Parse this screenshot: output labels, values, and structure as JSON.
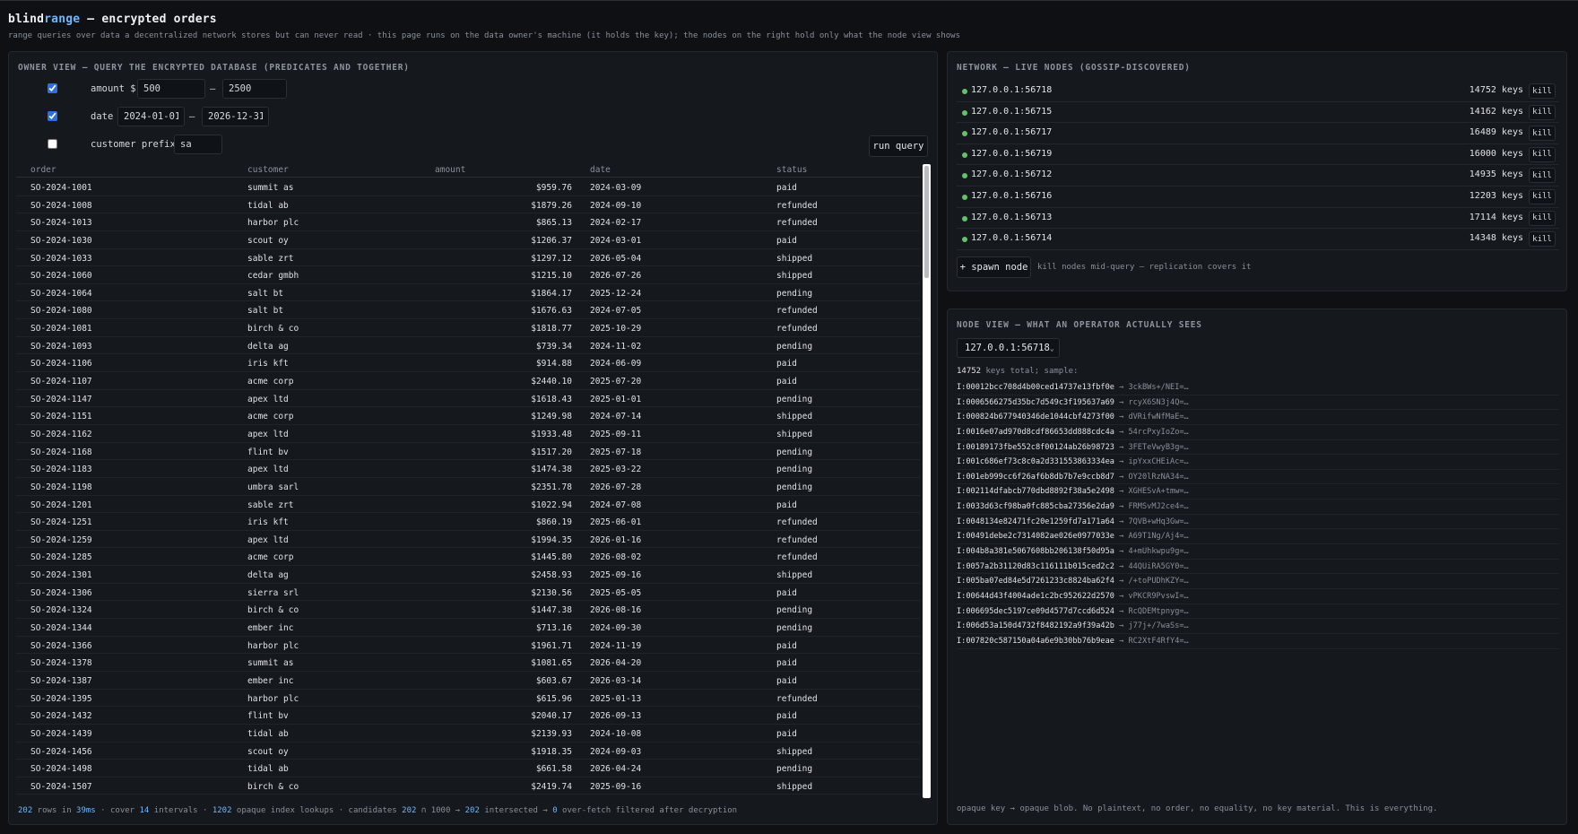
{
  "header": {
    "title_a": "blind",
    "title_b": "range",
    "title_c": " — encrypted orders",
    "subtitle": "range queries over data a decentralized network stores but can never read · this page runs on the data owner's machine (it holds the key); the nodes on the right hold only what the node view shows"
  },
  "owner": {
    "title": "owner view — query the encrypted database (predicates and together)",
    "filters": {
      "amount_label": "amount $",
      "amount_min": "500",
      "amount_max": "2500",
      "date_label": "date",
      "date_min": "2024-01-01",
      "date_max": "2026-12-31",
      "prefix_label": "customer prefix",
      "prefix_value": "sa",
      "dash": "—"
    },
    "run_label": "run query",
    "columns": {
      "order": "order",
      "customer": "customer",
      "amount": "amount",
      "date": "date",
      "status": "status"
    },
    "rows": [
      [
        "SO-2024-1001",
        "summit as",
        "$959.76",
        "2024-03-09",
        "paid"
      ],
      [
        "SO-2024-1008",
        "tidal ab",
        "$1879.26",
        "2024-09-10",
        "refunded"
      ],
      [
        "SO-2024-1013",
        "harbor plc",
        "$865.13",
        "2024-02-17",
        "refunded"
      ],
      [
        "SO-2024-1030",
        "scout oy",
        "$1206.37",
        "2024-03-01",
        "paid"
      ],
      [
        "SO-2024-1033",
        "sable zrt",
        "$1297.12",
        "2026-05-04",
        "shipped"
      ],
      [
        "SO-2024-1060",
        "cedar gmbh",
        "$1215.10",
        "2026-07-26",
        "shipped"
      ],
      [
        "SO-2024-1064",
        "salt bt",
        "$1864.17",
        "2025-12-24",
        "pending"
      ],
      [
        "SO-2024-1080",
        "salt bt",
        "$1676.63",
        "2024-07-05",
        "refunded"
      ],
      [
        "SO-2024-1081",
        "birch & co",
        "$1818.77",
        "2025-10-29",
        "refunded"
      ],
      [
        "SO-2024-1093",
        "delta ag",
        "$739.34",
        "2024-11-02",
        "pending"
      ],
      [
        "SO-2024-1106",
        "iris kft",
        "$914.88",
        "2024-06-09",
        "paid"
      ],
      [
        "SO-2024-1107",
        "acme corp",
        "$2440.10",
        "2025-07-20",
        "paid"
      ],
      [
        "SO-2024-1147",
        "apex ltd",
        "$1618.43",
        "2025-01-01",
        "pending"
      ],
      [
        "SO-2024-1151",
        "acme corp",
        "$1249.98",
        "2024-07-14",
        "shipped"
      ],
      [
        "SO-2024-1162",
        "apex ltd",
        "$1933.48",
        "2025-09-11",
        "shipped"
      ],
      [
        "SO-2024-1168",
        "flint bv",
        "$1517.20",
        "2025-07-18",
        "pending"
      ],
      [
        "SO-2024-1183",
        "apex ltd",
        "$1474.38",
        "2025-03-22",
        "pending"
      ],
      [
        "SO-2024-1198",
        "umbra sarl",
        "$2351.78",
        "2026-07-28",
        "pending"
      ],
      [
        "SO-2024-1201",
        "sable zrt",
        "$1022.94",
        "2024-07-08",
        "paid"
      ],
      [
        "SO-2024-1251",
        "iris kft",
        "$860.19",
        "2025-06-01",
        "refunded"
      ],
      [
        "SO-2024-1259",
        "apex ltd",
        "$1994.35",
        "2026-01-16",
        "refunded"
      ],
      [
        "SO-2024-1285",
        "acme corp",
        "$1445.80",
        "2026-08-02",
        "refunded"
      ],
      [
        "SO-2024-1301",
        "delta ag",
        "$2458.93",
        "2025-09-16",
        "shipped"
      ],
      [
        "SO-2024-1306",
        "sierra srl",
        "$2130.56",
        "2025-05-05",
        "paid"
      ],
      [
        "SO-2024-1324",
        "birch & co",
        "$1447.38",
        "2026-08-16",
        "pending"
      ],
      [
        "SO-2024-1344",
        "ember inc",
        "$713.16",
        "2024-09-30",
        "pending"
      ],
      [
        "SO-2024-1366",
        "harbor plc",
        "$1961.71",
        "2024-11-19",
        "paid"
      ],
      [
        "SO-2024-1378",
        "summit as",
        "$1081.65",
        "2026-04-20",
        "paid"
      ],
      [
        "SO-2024-1387",
        "ember inc",
        "$603.67",
        "2026-03-14",
        "paid"
      ],
      [
        "SO-2024-1395",
        "harbor plc",
        "$615.96",
        "2025-01-13",
        "refunded"
      ],
      [
        "SO-2024-1432",
        "flint bv",
        "$2040.17",
        "2026-09-13",
        "paid"
      ],
      [
        "SO-2024-1439",
        "tidal ab",
        "$2139.93",
        "2024-10-08",
        "paid"
      ],
      [
        "SO-2024-1456",
        "scout oy",
        "$1918.35",
        "2024-09-03",
        "shipped"
      ],
      [
        "SO-2024-1498",
        "tidal ab",
        "$661.58",
        "2026-04-24",
        "pending"
      ],
      [
        "SO-2024-1507",
        "birch & co",
        "$2419.74",
        "2025-09-16",
        "shipped"
      ]
    ],
    "stats": {
      "rows": "202",
      "rows_text": " rows in ",
      "ms": "39ms",
      "cover_text": " · cover ",
      "intervals": "14",
      "intervals_text": " intervals · ",
      "lookups": "1202",
      "lookups_text": " opaque index lookups · candidates ",
      "cand_a": "202",
      "cap_text": " ∩ ",
      "cand_b": "1000",
      "arrow1": " → ",
      "intersected": "202",
      "inter_text": " intersected → ",
      "overfetch": "0",
      "over_text": " over-fetch filtered after decryption"
    }
  },
  "network": {
    "title": "network — live nodes (gossip-discovered)",
    "nodes": [
      {
        "addr": "127.0.0.1:56718",
        "keys": "14752 keys"
      },
      {
        "addr": "127.0.0.1:56715",
        "keys": "14162 keys"
      },
      {
        "addr": "127.0.0.1:56717",
        "keys": "16489 keys"
      },
      {
        "addr": "127.0.0.1:56719",
        "keys": "16000 keys"
      },
      {
        "addr": "127.0.0.1:56712",
        "keys": "14935 keys"
      },
      {
        "addr": "127.0.0.1:56716",
        "keys": "12203 keys"
      },
      {
        "addr": "127.0.0.1:56713",
        "keys": "17114 keys"
      },
      {
        "addr": "127.0.0.1:56714",
        "keys": "14348 keys"
      }
    ],
    "kill_label": "kill",
    "spawn_label": "+ spawn node",
    "spawn_hint": "kill nodes mid-query — replication covers it",
    "status_color": "#62c26b"
  },
  "nodeview": {
    "title": "node view — what an operator actually sees",
    "selected": "127.0.0.1:56718",
    "keys_total": "14752",
    "keys_text": " keys total; sample:",
    "arrow": " → ",
    "samples": [
      [
        "I:00012bcc708d4b00ced14737e13fbf0e",
        "3ckBWs+/NEI=…"
      ],
      [
        "I:0006566275d35bc7d549c3f195637a69",
        "rcyX6SN3j4Q=…"
      ],
      [
        "I:000824b677940346de1044cbf4273f00",
        "dVRifwNfMaE=…"
      ],
      [
        "I:0016e07ad970d8cdf86653dd888cdc4a",
        "54rcPxyIoZo=…"
      ],
      [
        "I:00189173fbe552c8f00124ab26b98723",
        "3FETeVwyB3g=…"
      ],
      [
        "I:001c686ef73c8c0a2d331553863334ea",
        "ipYxxCHEiAc=…"
      ],
      [
        "I:001eb999cc6f26af6b8db7b7e9ccb8d7",
        "OY20lRzNA34=…"
      ],
      [
        "I:002114dfabcb770dbd8892f38a5e2498",
        "XGHESvA+tmw=…"
      ],
      [
        "I:0033d63cf98ba0fc885cba27356e2da9",
        "FRMSvMJ2ce4=…"
      ],
      [
        "I:0048134e82471fc20e1259fd7a171a64",
        "7QVB+wHq3Gw=…"
      ],
      [
        "I:00491debe2c7314082ae026e0977033e",
        "A69T1Ng/Aj4=…"
      ],
      [
        "I:004b8a381e5067608bb206138f50d95a",
        "4+mUhkwpu9g=…"
      ],
      [
        "I:0057a2b31120d83c116111b015ced2c2",
        "44QUiRA5GY0=…"
      ],
      [
        "I:005ba07ed84e5d7261233c8824ba62f4",
        "/+toPUDhKZY=…"
      ],
      [
        "I:00644d43f4004ade1c2bc952622d2570",
        "vPKCR9PvswI=…"
      ],
      [
        "I:006695dec5197ce09d4577d7ccd6d524",
        "RcQDEMtpnyg=…"
      ],
      [
        "I:006d53a150d4732f8482192a9f39a42b",
        "j77j+/7waSs=…"
      ],
      [
        "I:007820c587150a04a6e9b30bb76b9eae",
        "RC2XtF4RfY4=…"
      ]
    ],
    "footer": "opaque key → opaque blob. No plaintext, no order, no equality, no key material. This is everything."
  },
  "colors": {
    "accent": "#6fb7ff",
    "ok": "#62c26b",
    "panel": "#15181d",
    "bg": "#0e1014"
  }
}
